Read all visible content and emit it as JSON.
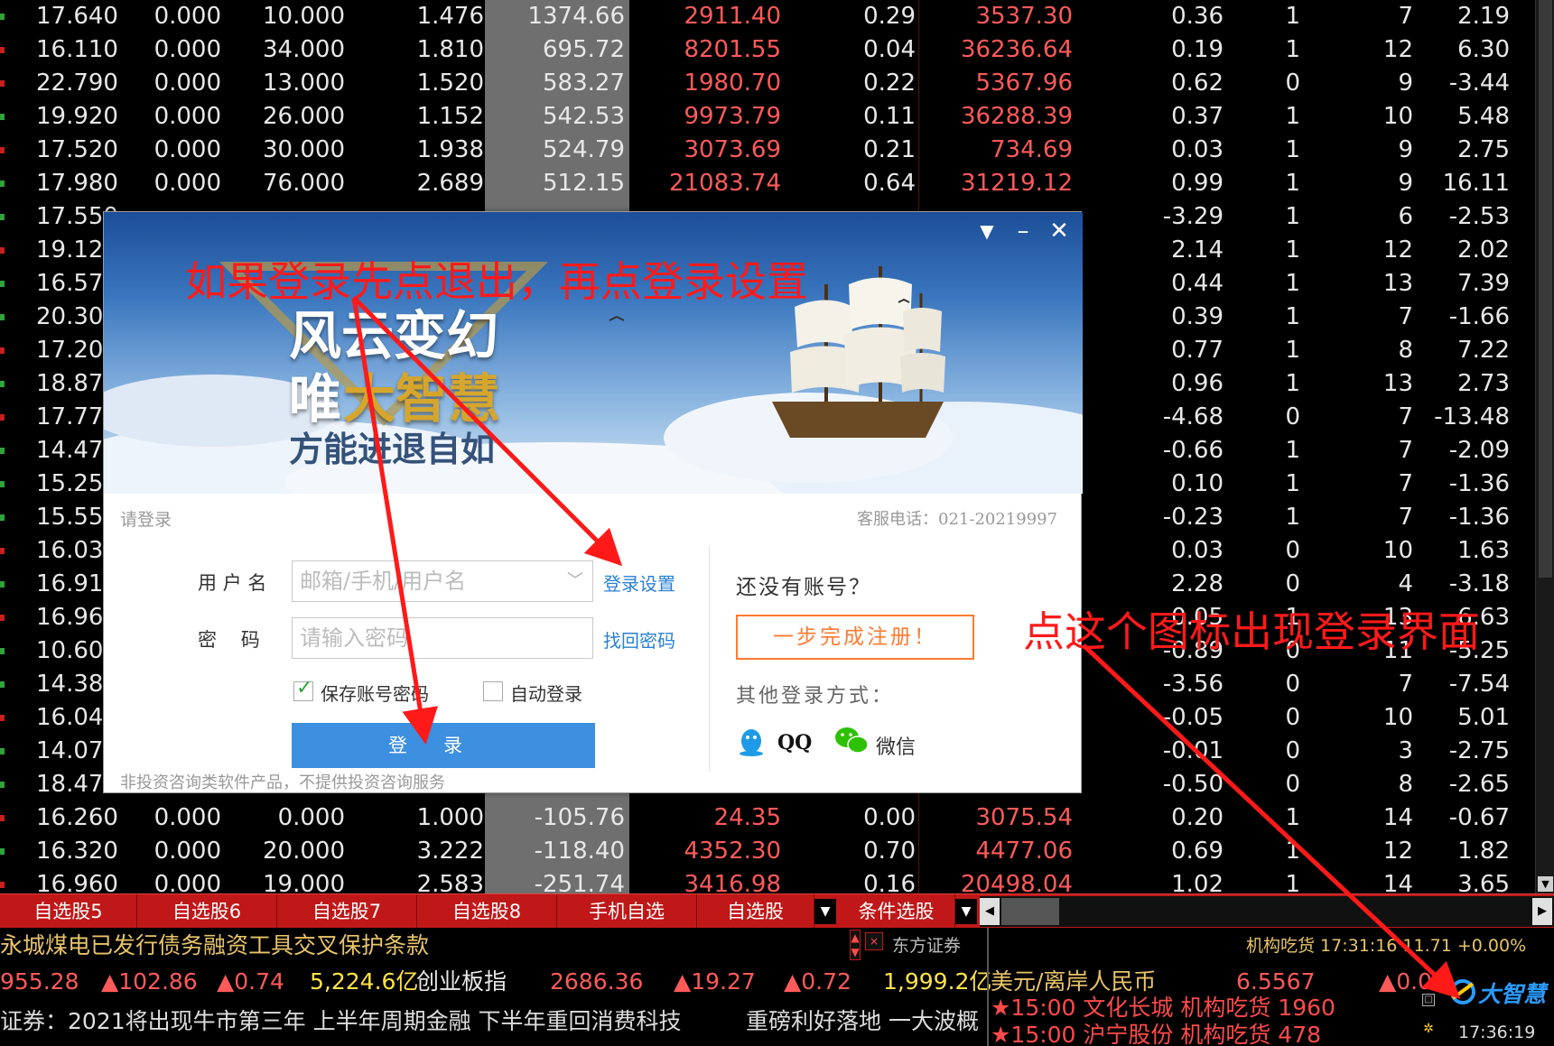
{
  "stock_rows": [
    {
      "c1": "17.640",
      "c2": "0.000",
      "c3": "10.000",
      "c4": "1.476",
      "c5": "1374.66",
      "c6": "2911.40",
      "c7": "0.29",
      "c8": "3537.30",
      "c9": "0.36",
      "c10": "1",
      "c11": "7",
      "c12": "2.19",
      "dot": "g"
    },
    {
      "c1": "16.110",
      "c2": "0.000",
      "c3": "34.000",
      "c4": "1.810",
      "c5": "695.72",
      "c6": "8201.55",
      "c7": "0.04",
      "c8": "36236.64",
      "c9": "0.19",
      "c10": "1",
      "c11": "12",
      "c12": "6.30",
      "dot": "r"
    },
    {
      "c1": "22.790",
      "c2": "0.000",
      "c3": "13.000",
      "c4": "1.520",
      "c5": "583.27",
      "c6": "1980.70",
      "c7": "0.22",
      "c8": "5367.96",
      "c9": "0.62",
      "c10": "0",
      "c11": "9",
      "c12": "-3.44",
      "dot": "r"
    },
    {
      "c1": "19.920",
      "c2": "0.000",
      "c3": "26.000",
      "c4": "1.152",
      "c5": "542.53",
      "c6": "9973.79",
      "c7": "0.11",
      "c8": "36288.39",
      "c9": "0.37",
      "c10": "1",
      "c11": "10",
      "c12": "5.48",
      "dot": "g"
    },
    {
      "c1": "17.520",
      "c2": "0.000",
      "c3": "30.000",
      "c4": "1.938",
      "c5": "524.79",
      "c6": "3073.69",
      "c7": "0.21",
      "c8": "734.69",
      "c9": "0.03",
      "c10": "1",
      "c11": "9",
      "c12": "2.75",
      "dot": "r"
    },
    {
      "c1": "17.980",
      "c2": "0.000",
      "c3": "76.000",
      "c4": "2.689",
      "c5": "512.15",
      "c6": "21083.74",
      "c7": "0.64",
      "c8": "31219.12",
      "c9": "0.99",
      "c10": "1",
      "c11": "9",
      "c12": "16.11",
      "dot": "g"
    },
    {
      "c1": "17.550",
      "c2": "",
      "c3": "",
      "c4": "",
      "c5": "",
      "c6": "",
      "c7": "",
      "c8": "",
      "c9": "-3.29",
      "c10": "1",
      "c11": "6",
      "c12": "-2.53",
      "dot": "g"
    },
    {
      "c1": "19.120",
      "c2": "",
      "c3": "",
      "c4": "",
      "c5": "",
      "c6": "",
      "c7": "",
      "c8": "",
      "c9": "2.14",
      "c10": "1",
      "c11": "12",
      "c12": "2.02",
      "dot": "r"
    },
    {
      "c1": "16.570",
      "c2": "",
      "c3": "",
      "c4": "",
      "c5": "",
      "c6": "",
      "c7": "",
      "c8": "",
      "c9": "0.44",
      "c10": "1",
      "c11": "13",
      "c12": "7.39",
      "dot": "g"
    },
    {
      "c1": "20.300",
      "c2": "",
      "c3": "",
      "c4": "",
      "c5": "",
      "c6": "",
      "c7": "",
      "c8": "",
      "c9": "0.39",
      "c10": "1",
      "c11": "7",
      "c12": "-1.66",
      "dot": "g"
    },
    {
      "c1": "17.200",
      "c2": "",
      "c3": "",
      "c4": "",
      "c5": "",
      "c6": "",
      "c7": "",
      "c8": "",
      "c9": "0.77",
      "c10": "1",
      "c11": "8",
      "c12": "7.22",
      "dot": "r"
    },
    {
      "c1": "18.870",
      "c2": "",
      "c3": "",
      "c4": "",
      "c5": "",
      "c6": "",
      "c7": "",
      "c8": "",
      "c9": "0.96",
      "c10": "1",
      "c11": "13",
      "c12": "2.73",
      "dot": "g"
    },
    {
      "c1": "17.770",
      "c2": "",
      "c3": "",
      "c4": "",
      "c5": "",
      "c6": "",
      "c7": "",
      "c8": "",
      "c9": "-4.68",
      "c10": "0",
      "c11": "7",
      "c12": "-13.48",
      "dot": "r"
    },
    {
      "c1": "14.470",
      "c2": "",
      "c3": "",
      "c4": "",
      "c5": "",
      "c6": "",
      "c7": "",
      "c8": "",
      "c9": "-0.66",
      "c10": "1",
      "c11": "7",
      "c12": "-2.09",
      "dot": "g"
    },
    {
      "c1": "15.250",
      "c2": "",
      "c3": "",
      "c4": "",
      "c5": "",
      "c6": "",
      "c7": "",
      "c8": "",
      "c9": "0.10",
      "c10": "1",
      "c11": "7",
      "c12": "-1.36",
      "dot": "g"
    },
    {
      "c1": "15.550",
      "c2": "",
      "c3": "",
      "c4": "",
      "c5": "",
      "c6": "",
      "c7": "",
      "c8": "",
      "c9": "-0.23",
      "c10": "1",
      "c11": "7",
      "c12": "-1.36",
      "dot": "g"
    },
    {
      "c1": "16.030",
      "c2": "",
      "c3": "",
      "c4": "",
      "c5": "",
      "c6": "",
      "c7": "",
      "c8": "",
      "c9": "0.03",
      "c10": "0",
      "c11": "10",
      "c12": "1.63",
      "dot": "r"
    },
    {
      "c1": "16.910",
      "c2": "",
      "c3": "",
      "c4": "",
      "c5": "",
      "c6": "",
      "c7": "",
      "c8": "",
      "c9": "2.28",
      "c10": "0",
      "c11": "4",
      "c12": "-3.18",
      "dot": "g"
    },
    {
      "c1": "16.960",
      "c2": "",
      "c3": "",
      "c4": "",
      "c5": "",
      "c6": "",
      "c7": "",
      "c8": "",
      "c9": "0.05",
      "c10": "1",
      "c11": "13",
      "c12": "6.63",
      "dot": "r"
    },
    {
      "c1": "10.600",
      "c2": "",
      "c3": "",
      "c4": "",
      "c5": "",
      "c6": "",
      "c7": "",
      "c8": "",
      "c9": "-0.89",
      "c10": "0",
      "c11": "11",
      "c12": "-5.25",
      "dot": "g"
    },
    {
      "c1": "14.380",
      "c2": "",
      "c3": "",
      "c4": "",
      "c5": "",
      "c6": "",
      "c7": "",
      "c8": "",
      "c9": "-3.56",
      "c10": "0",
      "c11": "7",
      "c12": "-7.54",
      "dot": "g"
    },
    {
      "c1": "16.040",
      "c2": "",
      "c3": "",
      "c4": "",
      "c5": "",
      "c6": "",
      "c7": "",
      "c8": "",
      "c9": "-0.05",
      "c10": "0",
      "c11": "10",
      "c12": "5.01",
      "dot": "r"
    },
    {
      "c1": "14.070",
      "c2": "",
      "c3": "",
      "c4": "",
      "c5": "",
      "c6": "",
      "c7": "",
      "c8": "",
      "c9": "-0.01",
      "c10": "0",
      "c11": "3",
      "c12": "-2.75",
      "dot": "g"
    },
    {
      "c1": "18.470",
      "c2": "",
      "c3": "",
      "c4": "",
      "c5": "",
      "c6": "",
      "c7": "",
      "c8": "",
      "c9": "-0.50",
      "c10": "0",
      "c11": "8",
      "c12": "-2.65",
      "dot": "g"
    },
    {
      "c1": "16.260",
      "c2": "0.000",
      "c3": "0.000",
      "c4": "1.000",
      "c5": "-105.76",
      "c6": "24.35",
      "c7": "0.00",
      "c8": "3075.54",
      "c9": "0.20",
      "c10": "1",
      "c11": "14",
      "c12": "-0.67",
      "dot": "r"
    },
    {
      "c1": "16.320",
      "c2": "0.000",
      "c3": "20.000",
      "c4": "3.222",
      "c5": "-118.40",
      "c6": "4352.30",
      "c7": "0.70",
      "c8": "4477.06",
      "c9": "0.69",
      "c10": "1",
      "c11": "12",
      "c12": "1.82",
      "dot": "g"
    },
    {
      "c1": "16.960",
      "c2": "0.000",
      "c3": "19.000",
      "c4": "2.583",
      "c5": "-251.74",
      "c6": "3416.98",
      "c7": "0.16",
      "c8": "20498.04",
      "c9": "1.02",
      "c10": "1",
      "c11": "14",
      "c12": "3.65",
      "dot": "r"
    }
  ],
  "tabs": [
    "自选股5",
    "自选股6",
    "自选股7",
    "自选股8",
    "手机自选",
    "自选股",
    "条件选股"
  ],
  "ticker": {
    "news": "永城煤电已发行债务融资工具交叉保护条款",
    "broker": "东方证券",
    "jg_line": "机构吃货  17:31:16 11.71 +0.00%",
    "index_values": [
      "955.28",
      "▲102.86",
      "▲0.74",
      "5,224.6亿"
    ],
    "index2_name": "创业板指",
    "index2_values": [
      "2686.36",
      "▲19.27",
      "▲0.72",
      "1,999.2亿"
    ],
    "fx_name": "美元/离岸人民币",
    "fx_value": "6.5567",
    "fx_change": "▲0.00",
    "scroll_news": "证券：2021将出现牛市第三年 上半年周期金融 下半年重回消费科技",
    "scroll_news2": "重磅利好落地 一大波概",
    "alerts": [
      "★15:00 文化长城 机构吃货 1960",
      "★15:00 沪宁股份 机构吃货 478"
    ],
    "logo_text": "大智慧",
    "clock": "17:36:19"
  },
  "dialog": {
    "banner_line1": "风云变幻",
    "banner_line2_a": "唯",
    "banner_line2_b": "大智慧",
    "banner_line3": "方能进退自如",
    "please_login": "请登录",
    "hotline": "客服电话：021-20219997",
    "username_label": "用 户 名",
    "username_placeholder": "邮箱/手机/用户名",
    "password_label": "密    码",
    "password_placeholder": "请输入密码",
    "login_settings": "登录设置",
    "find_password": "找回密码",
    "save_password": "保存账号密码",
    "auto_login": "自动登录",
    "login_button": "登录",
    "no_account": "还没有账号？",
    "register_button": "一步完成注册！",
    "other_login": "其他登录方式：",
    "qq": "QQ",
    "wechat": "微信",
    "disclaimer": "非投资咨询类软件产品，不提供投资咨询服务"
  },
  "annotations": {
    "top": "如果登录先点退出，再点登录设置",
    "right": "点这个图标出现登录界面"
  },
  "colors": {
    "accent_red": "#ff1a1a",
    "tab_red": "#c01818",
    "login_blue": "#3d8fe0",
    "register_orange": "#ff7a30"
  }
}
